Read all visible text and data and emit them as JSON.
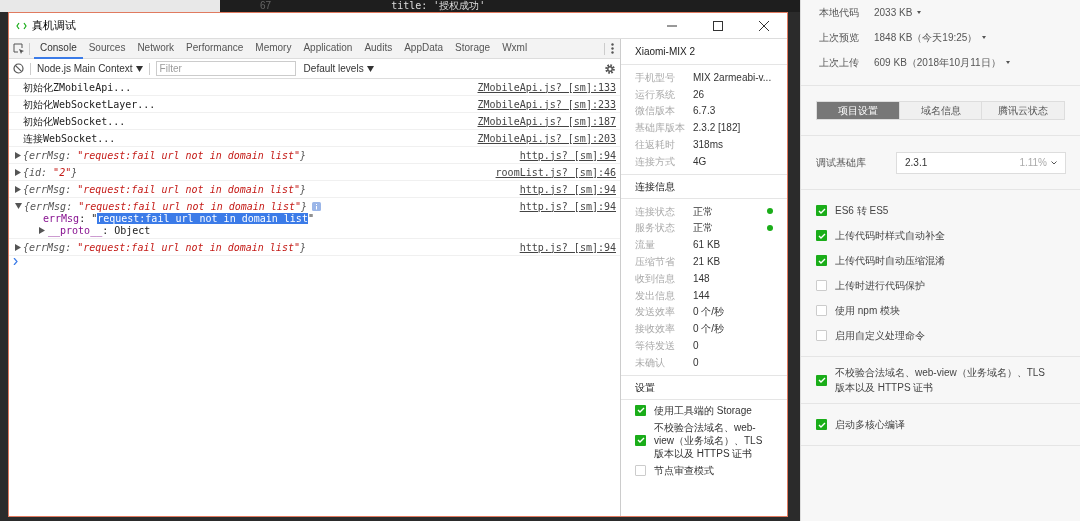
{
  "editor": {
    "line_number": "67",
    "code": "title: '授权成功'"
  },
  "window": {
    "title": "真机调试",
    "tabs": [
      {
        "label": "Console",
        "selected": true
      },
      {
        "label": "Sources",
        "selected": false
      },
      {
        "label": "Network",
        "selected": false
      },
      {
        "label": "Performance",
        "selected": false
      },
      {
        "label": "Memory",
        "selected": false
      },
      {
        "label": "Application",
        "selected": false
      },
      {
        "label": "Audits",
        "selected": false
      },
      {
        "label": "AppData",
        "selected": false
      },
      {
        "label": "Storage",
        "selected": false
      },
      {
        "label": "Wxml",
        "selected": false
      }
    ],
    "context": "Node.js Main Context",
    "filter_placeholder": "Filter",
    "levels": "Default levels",
    "console": [
      {
        "kind": "log",
        "text": "初始化ZMobileApi...",
        "source": "ZMobileApi.js? [sm]:133"
      },
      {
        "kind": "log",
        "text": "初始化WebSocketLayer...",
        "source": "ZMobileApi.js? [sm]:233"
      },
      {
        "kind": "log",
        "text": "初始化WebSocket...",
        "source": "ZMobileApi.js? [sm]:187"
      },
      {
        "kind": "log",
        "text": "连接WebSocket...",
        "source": "ZMobileApi.js? [sm]:203"
      },
      {
        "kind": "object",
        "expanded": false,
        "key": "{errMsg: ",
        "value": "\"request:fail url not in domain list\"",
        "end": "}",
        "source": "http.js? [sm]:94"
      },
      {
        "kind": "object",
        "expanded": false,
        "key": "{id: ",
        "value": "\"2\"",
        "end": "}",
        "source": "roomList.js? [sm]:46"
      },
      {
        "kind": "object",
        "expanded": false,
        "key": "{errMsg: ",
        "value": "\"request:fail url not in domain list\"",
        "end": "}",
        "source": "http.js? [sm]:94"
      },
      {
        "kind": "object",
        "expanded": true,
        "key": "{errMsg: ",
        "value": "\"request:fail url not in domain list\"",
        "end": "}",
        "source": "http.js? [sm]:94",
        "children": [
          {
            "kind": "string",
            "key": "errMsg",
            "before": ": \"",
            "selection": "request:fail url not in domain list",
            "after": "\""
          },
          {
            "kind": "proto",
            "key": "__proto__",
            "value": ": Object"
          }
        ]
      },
      {
        "kind": "object",
        "expanded": false,
        "key": "{errMsg: ",
        "value": "\"request:fail url not in domain list\"",
        "end": "}",
        "source": "http.js? [sm]:94"
      }
    ],
    "device": {
      "name": "Xiaomi-MIX 2",
      "rows": [
        {
          "label": "手机型号",
          "value": "MIX 2armeabi-v..."
        },
        {
          "label": "运行系统",
          "value": "26"
        },
        {
          "label": "微信版本",
          "value": "6.7.3"
        },
        {
          "label": "基础库版本",
          "value": "2.3.2 [182]"
        },
        {
          "label": "往返耗时",
          "value": "318ms"
        },
        {
          "label": "连接方式",
          "value": "4G"
        }
      ],
      "connection_title": "连接信息",
      "connection": [
        {
          "label": "连接状态",
          "value": "正常",
          "color": "#1aad19"
        },
        {
          "label": "服务状态",
          "value": "正常",
          "color": "#1aad19"
        },
        {
          "label": "流量",
          "value": "61 KB"
        },
        {
          "label": "压缩节省",
          "value": "21 KB"
        },
        {
          "label": "收到信息",
          "value": "148"
        },
        {
          "label": "发出信息",
          "value": "144"
        },
        {
          "label": "发送效率",
          "value": "0 个/秒"
        },
        {
          "label": "接收效率",
          "value": "0 个/秒"
        },
        {
          "label": "等待发送",
          "value": "0"
        },
        {
          "label": "未确认",
          "value": "0"
        }
      ],
      "settings_title": "设置",
      "settings": [
        {
          "label": "使用工具端的 Storage",
          "checked": true
        },
        {
          "label": "不校验合法域名、web-view（业务域名）、TLS 版本以及 HTTPS 证书",
          "checked": true
        },
        {
          "label": "节点审查模式",
          "checked": false
        }
      ]
    }
  },
  "details": {
    "sizes": [
      {
        "label": "本地代码",
        "value": "2033 KB"
      },
      {
        "label": "上次预览",
        "value": "1848 KB（今天19:25）"
      },
      {
        "label": "上次上传",
        "value": "609 KB（2018年10月11日）"
      }
    ],
    "tabs": [
      {
        "label": "项目设置",
        "selected": true
      },
      {
        "label": "域名信息",
        "selected": false
      },
      {
        "label": "腾讯云状态",
        "selected": false
      }
    ],
    "library": {
      "label": "调试基础库",
      "value": "2.3.1",
      "share": "1.11%"
    },
    "option_groups": [
      [
        {
          "label": "ES6 转 ES5",
          "checked": true
        },
        {
          "label": "上传代码时样式自动补全",
          "checked": true
        },
        {
          "label": "上传代码时自动压缩混淆",
          "checked": true
        },
        {
          "label": "上传时进行代码保护",
          "checked": false
        },
        {
          "label": "使用 npm 模块",
          "checked": false
        },
        {
          "label": "启用自定义处理命令",
          "checked": false
        }
      ],
      [
        {
          "label": "不校验合法域名、web-view（业务域名）、TLS 版本以及 HTTPS 证书",
          "checked": true
        }
      ],
      [
        {
          "label": "启动多核心编译",
          "checked": true
        }
      ]
    ]
  }
}
